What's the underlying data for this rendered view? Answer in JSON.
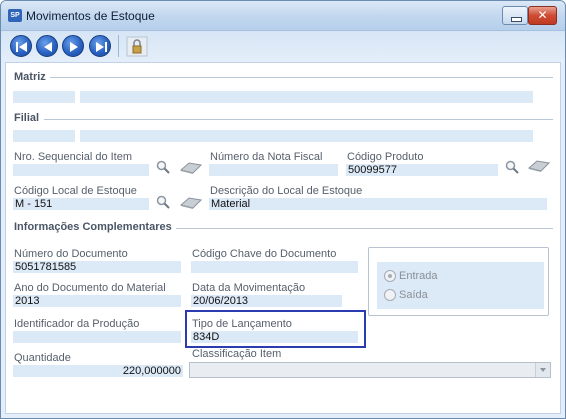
{
  "window": {
    "title": "Movimentos de Estoque",
    "app_icon_text": "SP"
  },
  "toolbar": {
    "buttons": [
      "first-record",
      "previous-record",
      "next-record",
      "last-record",
      "lock"
    ]
  },
  "sections": {
    "matriz": "Matriz",
    "filial": "Filial",
    "info": "Informações Complementares"
  },
  "fields": {
    "nro_sequencial": {
      "label": "Nro. Sequencial do Item",
      "value": ""
    },
    "numero_nota": {
      "label": "Número da Nota Fiscal",
      "value": ""
    },
    "codigo_produto": {
      "label": "Código Produto",
      "value": "50099577"
    },
    "codigo_local": {
      "label": "Código Local de Estoque",
      "value": "M - 151"
    },
    "descricao_local": {
      "label": "Descrição do Local de Estoque",
      "value": "Material"
    },
    "numero_documento": {
      "label": "Número do Documento",
      "value": "5051781585"
    },
    "codigo_chave": {
      "label": "Código Chave do Documento",
      "value": ""
    },
    "ano_documento": {
      "label": "Ano do Documento do Material",
      "value": "2013"
    },
    "data_movimentacao": {
      "label": "Data da Movimentação",
      "value": "20/06/2013"
    },
    "identificador_producao": {
      "label": "Identificador da Produção",
      "value": ""
    },
    "tipo_lancamento": {
      "label": "Tipo de Lançamento",
      "value": "834D"
    },
    "quantidade": {
      "label": "Quantidade",
      "value": "220,000000"
    },
    "classificacao_item": {
      "label": "Classificação Item",
      "value": ""
    }
  },
  "movement_type": {
    "options": [
      "Entrada",
      "Saída"
    ],
    "selected": "Entrada",
    "enabled": false
  },
  "colors": {
    "field_bg": "#dce9f7",
    "highlight_border": "#2b3bb0",
    "title_gradient_top": "#dbe8f6"
  }
}
